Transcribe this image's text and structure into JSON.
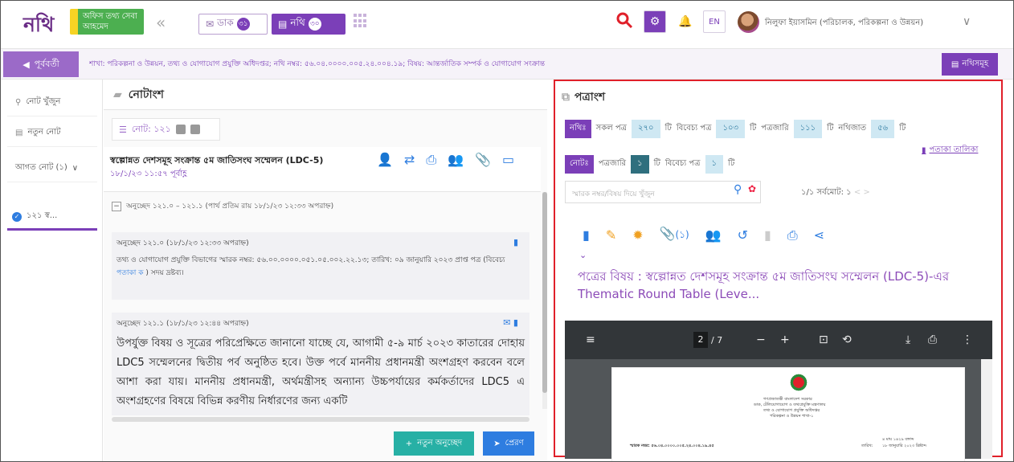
{
  "brand": {
    "logo": "নথি",
    "badge": "অফিস তথ্য সেবা আহমেদ"
  },
  "header": {
    "dak_label": "ডাক",
    "dak_count": "৩১",
    "nothi_label": "নথি",
    "nothi_count": "৩০",
    "lang": "EN",
    "user_name": "নিলুফা ইয়াসমিন (পরিচালক, পরিকল্পনা ও উন্নয়ন)"
  },
  "crumb": {
    "back_label": "পূর্ববর্তী",
    "text": "শাখা: পরিকল্পনা ও উন্নয়ন, তথ্য ও যোগাযোগ প্রযুক্তি অধিদপ্তর; নথি নম্বর: ৫৬.০৪.০০০০.০০৫.২৪.০০৪.১৯; বিষয়: আন্তর্জাতিক সম্পর্ক ও যোগাযোগ সংক্রান্ত",
    "nothis_label": "নথিসমূহ"
  },
  "left": {
    "search_label": "নোট খুঁজুন",
    "new_note_label": "নতুন নোট",
    "incoming_label": "আগত নোট (১)",
    "note_item_label": "১২১ স্ব..."
  },
  "middle": {
    "title": "নোটাংশ",
    "tab_label": "নোট: ১২১",
    "note_title": "স্বল্পোন্নত দেশসমূহ সংক্রান্ত ৫ম জাতিসংঘ সম্মেলন (LDC-5)",
    "note_date": "১৮/১/২৩ ১১:৫৭ পূর্বাহ্ণ",
    "para_head": "অনুচ্ছেদ ১২১.০ – ১২১.১ (পার্থ প্রতিম রায় ১৮/১/২৩ ১২:৩৩ অপরাহ্ন)",
    "para1_title": "অনুচ্ছেদ ১২১.০ (১৮/১/২৩ ১২:৩৩ অপরাহ্ন)",
    "para1_body": "তথ্য ও যোগাযোগ প্রযুক্তি বিভাগের স্মারক নম্বর: ৫৬.০০.০০০০.০৫১.০৫.০০২.২২.১৩; তারিখ: ০৯ জানুয়ারি ২০২৩ প্রাপ্ত পত্র (বিবেচ্য",
    "para1_link": "পতাকা ক",
    "para1_tail": ") সদয় দ্রষ্টব্য।",
    "para2_title": "অনুচ্ছেদ ১২১.১ (১৮/১/২৩ ১২:৪৪ অপরাহ্ন)",
    "para2_body": "উপর্যুক্ত বিষয় ও সূত্রের পরিপ্রেক্ষিতে জানানো যাচ্ছে যে, আগামী ৫-৯ মার্চ ২০২৩ কাতারের দোহায় LDC5 সম্মেলনের দ্বিতীয় পর্ব অনুষ্ঠিত হবে। উক্ত পর্বে মাননীয় প্রধানমন্ত্রী অংশগ্রহণ করবেন বলে আশা করা যায়। মাননীয় প্রধানমন্ত্রী, অর্থমন্ত্রীসহ অন্যান্য উচ্চপর্যায়ের কর্মকর্তাদের LDC5 এ অংশগ্রহণের বিষয়ে বিভিন্ন করণীয় নির্ধারণের জন্য একটি",
    "new_para_label": "নতুন অনুচ্ছেদ",
    "send_label": "প্রেরণ"
  },
  "right": {
    "title": "পত্রাংশ",
    "nothi_tag": "নথিঃ",
    "all_label": "সকল পত্র",
    "all_count": "২৭০",
    "unit": "টি",
    "consider_label": "বিবেচ্য পত্র",
    "consider_count": "১০৩",
    "issued_label": "পত্রজারি",
    "issued_count": "১১১",
    "filed_label": "নথিজাত",
    "filed_count": "৫৬",
    "note_tag": "নোটঃ",
    "note_issued_label": "পত্রজারি",
    "note_issued_count": "১",
    "note_consider_label": "বিবেচ্য পত্র",
    "note_consider_count": "১",
    "potaka_label": "পতাকা তালিকা",
    "search_placeholder": "স্মারক নম্বর/বিষয় দিয়ে খুঁজুন",
    "pager_text": "১/১ সর্বমোট: ১",
    "attach_count": "(১)",
    "subject": "পত্রের বিষয় : স্বল্পোন্নত দেশসমূহ সংক্রান্ত ৫ম জাতিসংঘ সম্মেলন (LDC-5)-এর Thematic Round Table (Leve...",
    "pdf_page": "2",
    "pdf_total": "/ 7",
    "pdf_gov": "গণপ্রজাতন্ত্রী বাংলাদেশ সরকার",
    "pdf_ministry": "ডাক, টেলিযোগাযোগ ও তথ্যপ্রযুক্তি মন্ত্রণালয়",
    "pdf_dept": "তথ্য ও যোগাযোগ প্রযুক্তি অধিদপ্তর",
    "pdf_section": "পরিকল্পনা ও উন্নয়ন শাখা-১",
    "pdf_ref": "স্মারক নম্বর: ৫৬.০৪.০০০০.০০৫.২৪.০০৪.১৯.৪৫",
    "pdf_date1": "৪ মাঘ ১৪২৯ বঙ্গাব্দ",
    "pdf_date2": "১৮ জানুয়ারি ২০২৩ খ্রিষ্টাব্দ",
    "pdf_date_label": "তারিখ:"
  },
  "colors": {
    "accent": "#7b3fb8",
    "highlight_border": "#e0202a",
    "teal": "#27b0a5",
    "blue": "#2e7de0"
  }
}
